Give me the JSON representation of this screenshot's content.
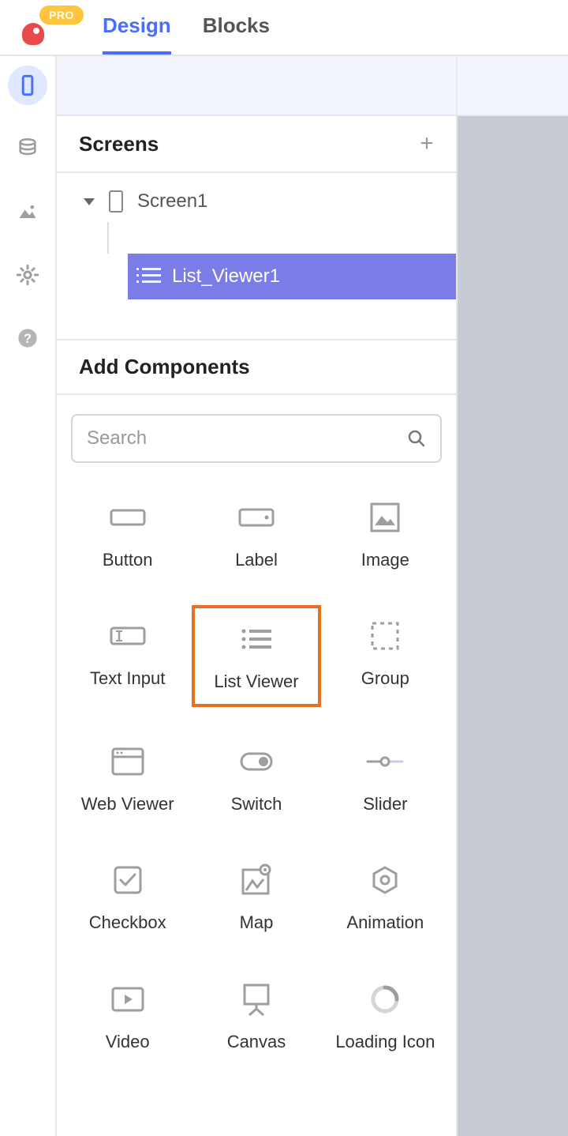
{
  "header": {
    "pro_label": "PRO",
    "tabs": {
      "design": "Design",
      "blocks": "Blocks"
    }
  },
  "screens": {
    "title": "Screens",
    "root": "Screen1",
    "child": "List_Viewer1"
  },
  "addcomp": {
    "title": "Add Components",
    "search_placeholder": "Search"
  },
  "components": {
    "button": "Button",
    "label": "Label",
    "image": "Image",
    "textinput": "Text Input",
    "listviewer": "List Viewer",
    "group": "Group",
    "webviewer": "Web Viewer",
    "switch": "Switch",
    "slider": "Slider",
    "checkbox": "Checkbox",
    "map": "Map",
    "animation": "Animation",
    "video": "Video",
    "canvas": "Canvas",
    "loadingicon": "Loading Icon"
  }
}
